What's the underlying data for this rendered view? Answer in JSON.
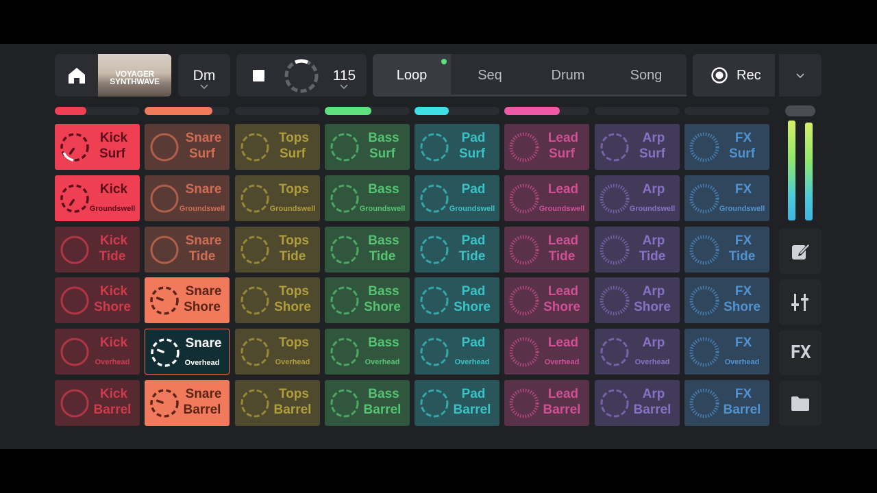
{
  "header": {
    "home_icon": "home-icon",
    "album": {
      "line1": "VOYAGER",
      "line2": "SYNTHWAVE"
    },
    "key": "Dm",
    "tempo": "115",
    "tabs": [
      {
        "label": "Loop",
        "active": true
      },
      {
        "label": "Seq"
      },
      {
        "label": "Drum"
      },
      {
        "label": "Song"
      }
    ],
    "record_label": "Rec"
  },
  "tracks": [
    {
      "name": "Kick",
      "color": "#ef3f53",
      "progress": 0.37
    },
    {
      "name": "Snare",
      "color": "#f07a5b",
      "progress": 0.8
    },
    {
      "name": "Tops",
      "color": "#c9b441",
      "progress": 0
    },
    {
      "name": "Bass",
      "color": "#5fe07e",
      "progress": 0.55
    },
    {
      "name": "Pad",
      "color": "#3ee0e3",
      "progress": 0.4
    },
    {
      "name": "Lead",
      "color": "#ef5aa6",
      "progress": 0.65
    },
    {
      "name": "Arp",
      "color": "#9a7fe0",
      "progress": 0
    },
    {
      "name": "FX",
      "color": "#5aa6ee",
      "progress": 0
    }
  ],
  "scenes": [
    "Surf",
    "Groundswell",
    "Tide",
    "Shore",
    "Overhead",
    "Barrel"
  ],
  "clip_states": {
    "0-0": "playing",
    "0-1": "playing",
    "1-3": "playing",
    "1-4": "queued",
    "1-5": "playing"
  },
  "side": {
    "edit_icon": "edit-icon",
    "mixer_icon": "mixer-sliders-icon",
    "fx_label": "FX",
    "folder_icon": "folder-icon"
  }
}
